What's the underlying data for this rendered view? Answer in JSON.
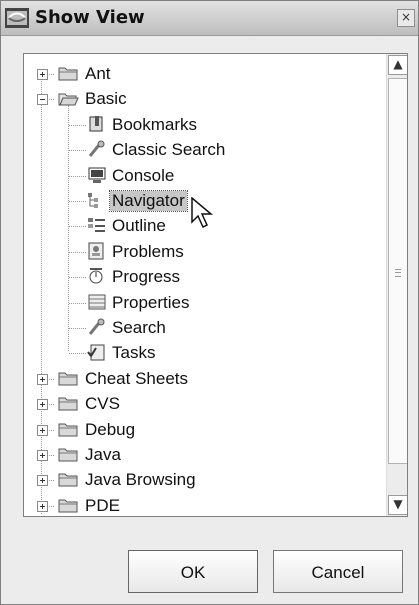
{
  "dialog": {
    "title": "Show View",
    "close_glyph": "×"
  },
  "tree": {
    "items": [
      {
        "type": "folder",
        "label": "Ant",
        "expanded": false,
        "icon": "folder-icon"
      },
      {
        "type": "folder",
        "label": "Basic",
        "expanded": true,
        "icon": "folder-open-icon"
      },
      {
        "type": "view",
        "label": "Bookmarks",
        "icon": "bookmark-icon"
      },
      {
        "type": "view",
        "label": "Classic Search",
        "icon": "search-icon"
      },
      {
        "type": "view",
        "label": "Console",
        "icon": "console-icon"
      },
      {
        "type": "view",
        "label": "Navigator",
        "icon": "navigator-icon",
        "selected": true
      },
      {
        "type": "view",
        "label": "Outline",
        "icon": "outline-icon"
      },
      {
        "type": "view",
        "label": "Problems",
        "icon": "problems-icon"
      },
      {
        "type": "view",
        "label": "Progress",
        "icon": "progress-icon"
      },
      {
        "type": "view",
        "label": "Properties",
        "icon": "properties-icon"
      },
      {
        "type": "view",
        "label": "Search",
        "icon": "search-icon"
      },
      {
        "type": "view",
        "label": "Tasks",
        "icon": "tasks-icon"
      },
      {
        "type": "folder",
        "label": "Cheat Sheets",
        "expanded": false,
        "icon": "folder-icon"
      },
      {
        "type": "folder",
        "label": "CVS",
        "expanded": false,
        "icon": "folder-icon"
      },
      {
        "type": "folder",
        "label": "Debug",
        "expanded": false,
        "icon": "folder-icon"
      },
      {
        "type": "folder",
        "label": "Java",
        "expanded": false,
        "icon": "folder-icon"
      },
      {
        "type": "folder",
        "label": "Java Browsing",
        "expanded": false,
        "icon": "folder-icon"
      },
      {
        "type": "folder",
        "label": "PDE",
        "expanded": false,
        "icon": "folder-icon"
      }
    ]
  },
  "buttons": {
    "ok": "OK",
    "cancel": "Cancel"
  },
  "colors": {
    "selection": "#c7c7c7",
    "folder": "#d7d7d7"
  }
}
